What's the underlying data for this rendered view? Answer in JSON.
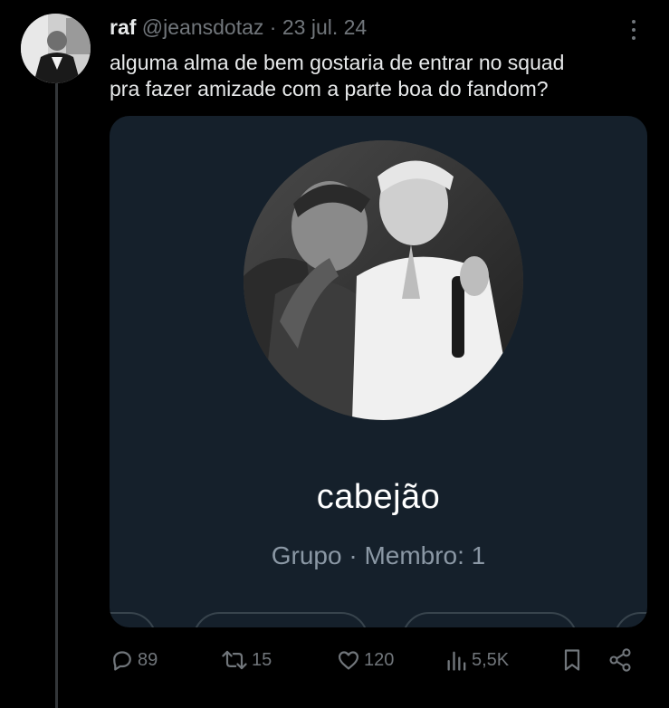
{
  "tweet": {
    "author_name": "raf",
    "handle": "@jeansdotaz",
    "separator": "·",
    "date": "23 jul. 24",
    "text_line1": "alguma alma de bem gostaria de entrar no squad",
    "text_line2": "pra fazer amizade com a parte boa do fandom?"
  },
  "card": {
    "group_name": "cabejão",
    "group_meta": "Grupo · Membro: 1"
  },
  "actions": {
    "replies": "89",
    "retweets": "15",
    "likes": "120",
    "views": "5,5K"
  },
  "icons": {
    "reply": "reply-icon",
    "retweet": "retweet-icon",
    "like": "heart-icon",
    "views": "views-icon",
    "bookmark": "bookmark-icon",
    "share": "share-icon",
    "more": "more-icon"
  },
  "colors": {
    "background": "#000000",
    "card_background": "#15202b",
    "text_primary": "#e7e9ea",
    "text_secondary": "#71767b"
  }
}
